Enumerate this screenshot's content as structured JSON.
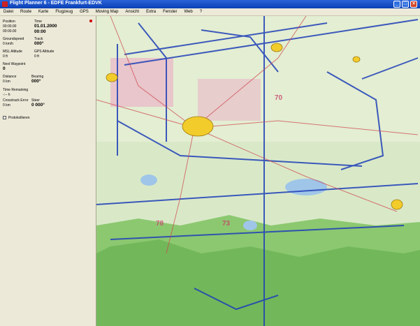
{
  "window": {
    "title": "Flight Planner 6 - EDFE Frankfurt-EDVK"
  },
  "menu": [
    "Datei",
    "Route",
    "Karte",
    "Flugzeug",
    "GPS",
    "Moving Map",
    "Ansicht",
    "Extra",
    "Fenster",
    "Web",
    "?"
  ],
  "panel": {
    "position_label": "Position",
    "position_lat": "00:00.00",
    "position_lon": "00:00.00",
    "time_label": "Time",
    "date": "01.01.2000",
    "time": "00:00",
    "groundspeed_label": "Groundspeed",
    "groundspeed_value": "0 km/h",
    "track_label": "Track",
    "track_value": "000°",
    "msl_label": "MSL Altitude",
    "msl_value": "0 ft",
    "gps_alt_label": "GPS Altitude",
    "gps_alt_value": "0 ft",
    "next_wp_label": "Next Waypoint",
    "next_wp_value": "0",
    "distance_label": "Distance",
    "distance_value": "0 km",
    "bearing_label": "Bearing",
    "bearing_value": "000°",
    "time_remaining_label": "Time Remaining",
    "time_remaining_value": "-:-- h",
    "crosstrack_label": "Crosstrack Error",
    "crosstrack_value": "0 km",
    "steer_label": "Steer",
    "steer_value": "0 000°",
    "log_label": "Protokollieren"
  },
  "colors": {
    "title_bar": "#0a3fb4",
    "airspace": "#1f3fb8",
    "restricted": "#c83c6a",
    "city": "#f2cc2a",
    "terrain_green": "#8cc870",
    "lake": "#9fc6e8"
  }
}
